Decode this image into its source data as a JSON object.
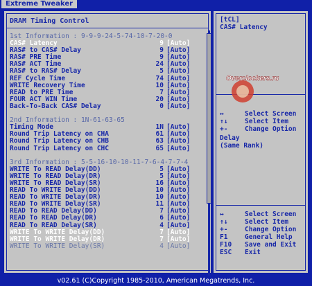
{
  "app": {
    "tab": "Extreme Tweaker"
  },
  "left": {
    "title": "DRAM Timing Control",
    "rows": [
      {
        "t": "info",
        "label": "1st Information : 9-9-9-24-5-74-10-7-20-0"
      },
      {
        "t": "hl",
        "label": "CAS# Latency",
        "value": "9",
        "auto": "[Auto]"
      },
      {
        "t": "item",
        "label": "RAS# to CAS# Delay",
        "value": "9",
        "auto": "[Auto]"
      },
      {
        "t": "item",
        "label": "RAS# PRE Time",
        "value": "9",
        "auto": "[Auto]"
      },
      {
        "t": "item",
        "label": "RAS# ACT Time",
        "value": "24",
        "auto": "[Auto]"
      },
      {
        "t": "item",
        "label": "RAS# to RAS# Delay",
        "value": "5",
        "auto": "[Auto]"
      },
      {
        "t": "item",
        "label": "REF Cycle Time",
        "value": "74",
        "auto": "[Auto]"
      },
      {
        "t": "item",
        "label": "WRITE Recovery Time",
        "value": "10",
        "auto": "[Auto]"
      },
      {
        "t": "item",
        "label": "READ to PRE Time",
        "value": "7",
        "auto": "[Auto]"
      },
      {
        "t": "item",
        "label": "FOUR ACT WIN Time",
        "value": "20",
        "auto": "[Auto]"
      },
      {
        "t": "item",
        "label": "Back-To-Back CAS# Delay",
        "value": "0",
        "auto": "[Auto]"
      },
      {
        "t": "blank",
        "label": ""
      },
      {
        "t": "info",
        "label": "2nd Information : 1N-61-63-65"
      },
      {
        "t": "item",
        "label": "Timing Mode",
        "value": "1N",
        "auto": "[Auto]"
      },
      {
        "t": "item",
        "label": "Round Trip Latency on CHA",
        "value": "61",
        "auto": "[Auto]"
      },
      {
        "t": "item",
        "label": "Round Trip Latency on CHB",
        "value": "63",
        "auto": "[Auto]"
      },
      {
        "t": "item",
        "label": "Round Trip Latency on CHC",
        "value": "65",
        "auto": "[Auto]"
      },
      {
        "t": "blank",
        "label": ""
      },
      {
        "t": "info",
        "label": "3rd Information : 5-5-16-10-10-11-7-6-4-7-7-4"
      },
      {
        "t": "item",
        "label": "WRITE To READ Delay(DD)",
        "value": "5",
        "auto": "[Auto]"
      },
      {
        "t": "item",
        "label": "WRITE To READ Delay(DR)",
        "value": "5",
        "auto": "[Auto]"
      },
      {
        "t": "item",
        "label": "WRITE To READ Delay(SR)",
        "value": "16",
        "auto": "[Auto]"
      },
      {
        "t": "item",
        "label": "READ To WRITE Delay(DD)",
        "value": "10",
        "auto": "[Auto]"
      },
      {
        "t": "item",
        "label": "READ To WRITE Delay(DR)",
        "value": "10",
        "auto": "[Auto]"
      },
      {
        "t": "item",
        "label": "READ To WRITE Delay(SR)",
        "value": "11",
        "auto": "[Auto]"
      },
      {
        "t": "item",
        "label": "READ To READ Delay(DD)",
        "value": "7",
        "auto": "[Auto]"
      },
      {
        "t": "item",
        "label": "READ To READ Delay(DR)",
        "value": "6",
        "auto": "[Auto]"
      },
      {
        "t": "item",
        "label": "READ To READ Delay(SR)",
        "value": "4",
        "auto": "[Auto]"
      },
      {
        "t": "white",
        "label": "WRITE To WRITE Delay(DD)",
        "value": "7",
        "auto": "[Auto]"
      },
      {
        "t": "white",
        "label": "WRITE To WRITE Delay(DR)",
        "value": "7",
        "auto": "[Auto]"
      },
      {
        "t": "gray",
        "label": "WRITE To WRITE Delay(SR)",
        "value": "4",
        "auto": "[Auto]"
      }
    ]
  },
  "right": {
    "help_top": "[tCL]\nCAS# Latency",
    "help_mid": "Delay\n(Same Rank)",
    "keys1": [
      {
        "k": "↔",
        "d": "Select Screen"
      },
      {
        "k": "↑↓",
        "d": "Select Item"
      },
      {
        "k": "+-",
        "d": "Change Option"
      }
    ],
    "keys2": [
      {
        "k": "↔",
        "d": "Select Screen"
      },
      {
        "k": "↑↓",
        "d": "Select Item"
      },
      {
        "k": "+-",
        "d": "Change Option"
      },
      {
        "k": "F1",
        "d": "General Help"
      },
      {
        "k": "F10",
        "d": "Save and Exit"
      },
      {
        "k": "ESC",
        "d": "Exit"
      }
    ]
  },
  "footer": "v02.61 (C)Copyright 1985-2010, American Megatrends, Inc.",
  "watermark": "Overclockers.ru",
  "colors": {
    "bg": "#1020a8",
    "panel": "#c4c4c4",
    "text": "#1828a8",
    "highlight": "#ffffff"
  }
}
